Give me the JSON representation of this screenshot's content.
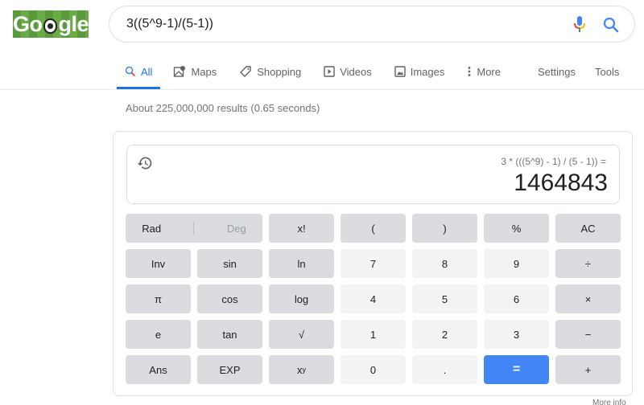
{
  "logo": {
    "text_pre": "Go",
    "text_post": "gle"
  },
  "search": {
    "query": "3((5^9-1)/(5-1))"
  },
  "tabs": [
    {
      "label": "All",
      "icon": "search-icon",
      "active": true
    },
    {
      "label": "Maps",
      "icon": "map-icon"
    },
    {
      "label": "Shopping",
      "icon": "tag-icon"
    },
    {
      "label": "Videos",
      "icon": "play-icon"
    },
    {
      "label": "Images",
      "icon": "image-icon"
    },
    {
      "label": "More",
      "icon": "more-vert-icon"
    }
  ],
  "tools": {
    "settings": "Settings",
    "tools": "Tools"
  },
  "result_stats": "About 225,000,000 results (0.65 seconds)",
  "calculator": {
    "expression": "3 * (((5^9) - 1) / (5 - 1)) =",
    "result": "1464843",
    "rad": "Rad",
    "deg": "Deg",
    "keys": [
      [
        "x!",
        "(",
        ")",
        "%",
        "AC"
      ],
      [
        "Inv",
        "sin",
        "ln",
        "7",
        "8",
        "9",
        "÷"
      ],
      [
        "π",
        "cos",
        "log",
        "4",
        "5",
        "6",
        "×"
      ],
      [
        "e",
        "tan",
        "√",
        "1",
        "2",
        "3",
        "−"
      ],
      [
        "Ans",
        "EXP",
        "x",
        "0",
        ".",
        "=",
        "+"
      ]
    ],
    "xy_sup": "y"
  },
  "colors": {
    "accent": "#1a73e8",
    "equals": "#4285f4"
  },
  "footer_partial": "More info"
}
